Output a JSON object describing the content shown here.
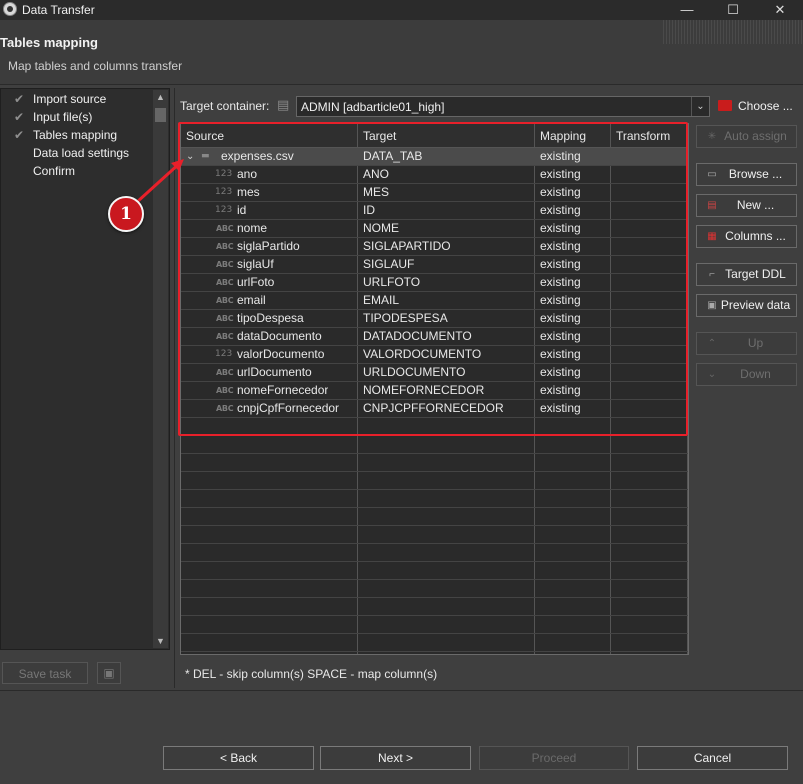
{
  "window": {
    "title": "Data Transfer",
    "controls": {
      "minimize": "—",
      "maximize": "☐",
      "close": "✕"
    }
  },
  "header": {
    "title": "Tables mapping",
    "subtitle": "Map tables and columns transfer"
  },
  "nav": {
    "items": [
      {
        "label": "Import source",
        "done": true
      },
      {
        "label": "Input file(s)",
        "done": true
      },
      {
        "label": "Tables mapping",
        "done": true
      },
      {
        "label": "Data load settings",
        "done": false
      },
      {
        "label": "Confirm",
        "done": false
      }
    ],
    "save_task": "Save task"
  },
  "target_container": {
    "label": "Target container:",
    "value": "ADMIN  [adbarticle01_high]",
    "choose_label": "Choose ..."
  },
  "table": {
    "headers": {
      "source": "Source",
      "target": "Target",
      "mapping": "Mapping",
      "transform": "Transform"
    },
    "parent": {
      "source": "expenses.csv",
      "target": "DATA_TAB",
      "mapping": "existing",
      "transform": ""
    },
    "rows": [
      {
        "type": "123",
        "source": "ano",
        "target": "ANO",
        "mapping": "existing"
      },
      {
        "type": "123",
        "source": "mes",
        "target": "MES",
        "mapping": "existing"
      },
      {
        "type": "123",
        "source": "id",
        "target": "ID",
        "mapping": "existing"
      },
      {
        "type": "ABC",
        "source": "nome",
        "target": "NOME",
        "mapping": "existing"
      },
      {
        "type": "ABC",
        "source": "siglaPartido",
        "target": "SIGLAPARTIDO",
        "mapping": "existing"
      },
      {
        "type": "ABC",
        "source": "siglaUf",
        "target": "SIGLAUF",
        "mapping": "existing"
      },
      {
        "type": "ABC",
        "source": "urlFoto",
        "target": "URLFOTO",
        "mapping": "existing"
      },
      {
        "type": "ABC",
        "source": "email",
        "target": "EMAIL",
        "mapping": "existing"
      },
      {
        "type": "ABC",
        "source": "tipoDespesa",
        "target": "TIPODESPESA",
        "mapping": "existing"
      },
      {
        "type": "ABC",
        "source": "dataDocumento",
        "target": "DATADOCUMENTO",
        "mapping": "existing"
      },
      {
        "type": "123",
        "source": "valorDocumento",
        "target": "VALORDOCUMENTO",
        "mapping": "existing"
      },
      {
        "type": "ABC",
        "source": "urlDocumento",
        "target": "URLDOCUMENTO",
        "mapping": "existing"
      },
      {
        "type": "ABC",
        "source": "nomeFornecedor",
        "target": "NOMEFORNECEDOR",
        "mapping": "existing"
      },
      {
        "type": "ABC",
        "source": "cnpjCpfFornecedor",
        "target": "CNPJCPFFORNECEDOR",
        "mapping": "existing"
      }
    ]
  },
  "hint": "* DEL - skip column(s)  SPACE - map column(s)",
  "callout": "1",
  "side_buttons": [
    {
      "label": "Auto assign",
      "icon": "auto-assign-icon",
      "enabled": false
    },
    {
      "label": "Browse ...",
      "icon": "browse-icon",
      "enabled": true
    },
    {
      "label": "New ...",
      "icon": "new-table-icon",
      "enabled": true
    },
    {
      "label": "Columns ...",
      "icon": "columns-icon",
      "enabled": true
    },
    {
      "label": "Target DDL",
      "icon": "ddl-icon",
      "enabled": true
    },
    {
      "label": "Preview data",
      "icon": "preview-icon",
      "enabled": true
    },
    {
      "label": "Up",
      "icon": "up-icon",
      "enabled": false
    },
    {
      "label": "Down",
      "icon": "down-icon",
      "enabled": false
    }
  ],
  "footer": {
    "back": "< Back",
    "next": "Next >",
    "proceed": "Proceed",
    "cancel": "Cancel"
  },
  "colors": {
    "highlight": "#e8202a",
    "callout": "#c9181f"
  }
}
